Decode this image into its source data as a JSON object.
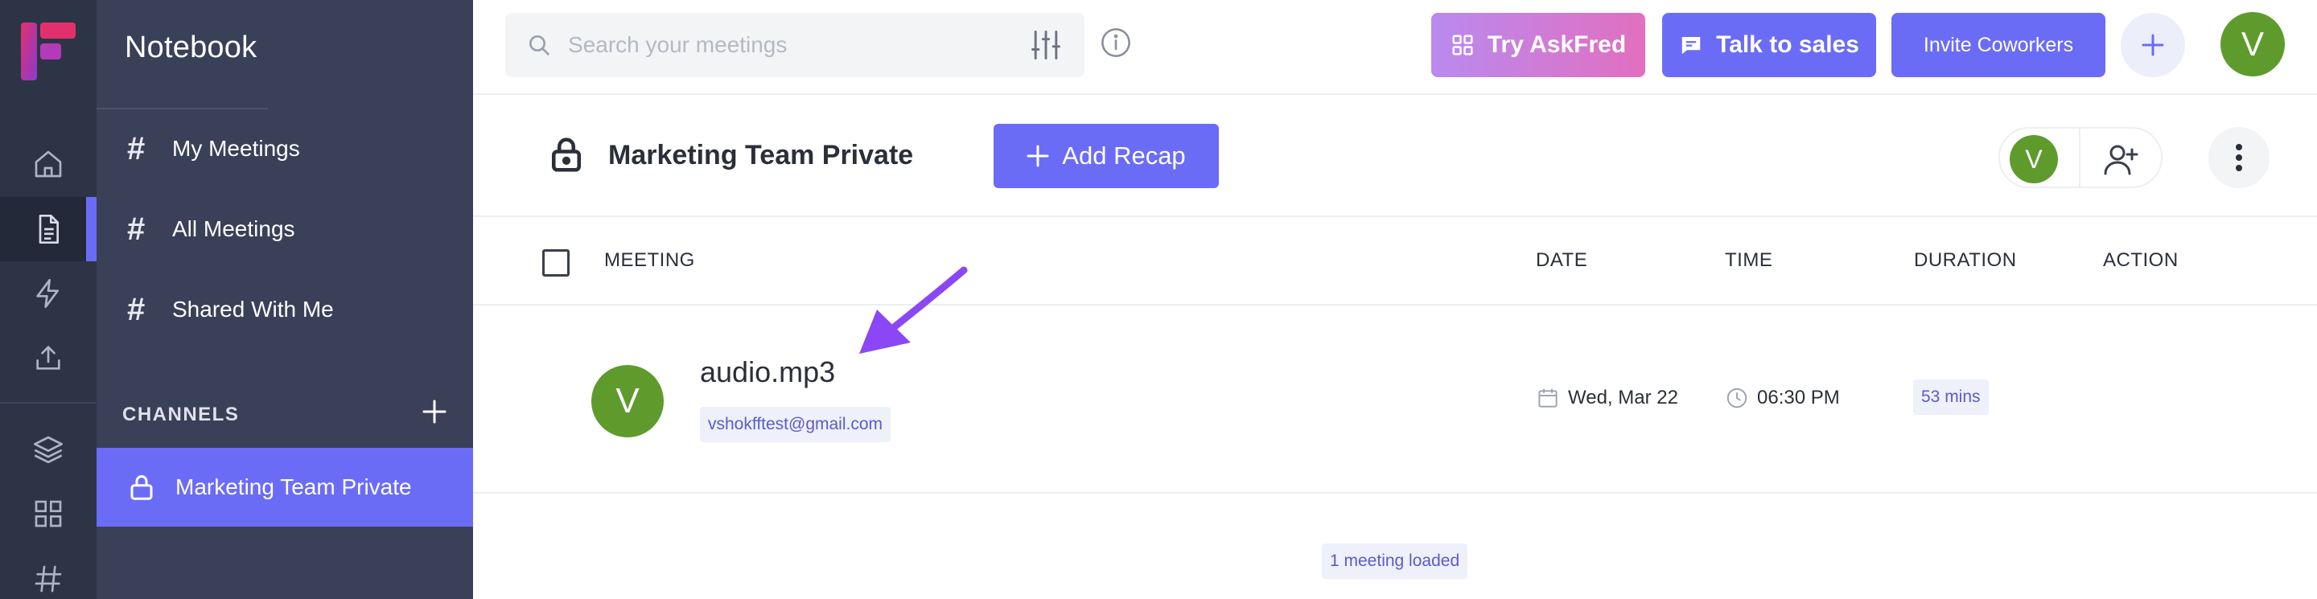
{
  "colors": {
    "rail_bg": "#2d3446",
    "sidebar_bg": "#394058",
    "accent": "#6b6cf6",
    "askfred_gradient_start": "#b98af0",
    "askfred_gradient_end": "#e26fbf",
    "avatar_green": "#5e9b2c",
    "chip_bg": "#eef0fa",
    "chip_text": "#5a5cc8",
    "annotation_arrow": "#8b47f5"
  },
  "rail": {
    "icons": [
      "home-icon",
      "notebook-icon",
      "bolt-icon",
      "upload-icon",
      "layers-icon",
      "apps-grid-icon",
      "hash-icon"
    ],
    "active": "notebook-icon"
  },
  "sidebar": {
    "title": "Notebook",
    "items": [
      {
        "label": "My Meetings",
        "icon": "hash-icon"
      },
      {
        "label": "All Meetings",
        "icon": "hash-icon",
        "active": true
      },
      {
        "label": "Shared With Me",
        "icon": "hash-icon"
      }
    ],
    "channels_label": "CHANNELS",
    "channels": [
      {
        "label": "Marketing Team Private",
        "icon": "lock-icon",
        "active": true
      }
    ]
  },
  "topbar": {
    "search_placeholder": "Search your meetings",
    "askfred_label": "Try AskFred",
    "sales_label": "Talk to sales",
    "invite_label": "Invite Coworkers",
    "plus_symbol": "+",
    "user_initial": "V"
  },
  "channel": {
    "title": "Marketing Team Private",
    "add_recap_label": "Add Recap",
    "member_initial": "V"
  },
  "table": {
    "headers": {
      "meeting": "MEETING",
      "date": "DATE",
      "time": "TIME",
      "duration": "DURATION",
      "action": "ACTION"
    },
    "rows": [
      {
        "initial": "V",
        "name": "audio.mp3",
        "email": "vshokfftest@gmail.com",
        "date": "Wed, Mar 22",
        "time": "06:30 PM",
        "duration": "53 mins"
      }
    ],
    "loaded_text": "1 meeting loaded"
  }
}
